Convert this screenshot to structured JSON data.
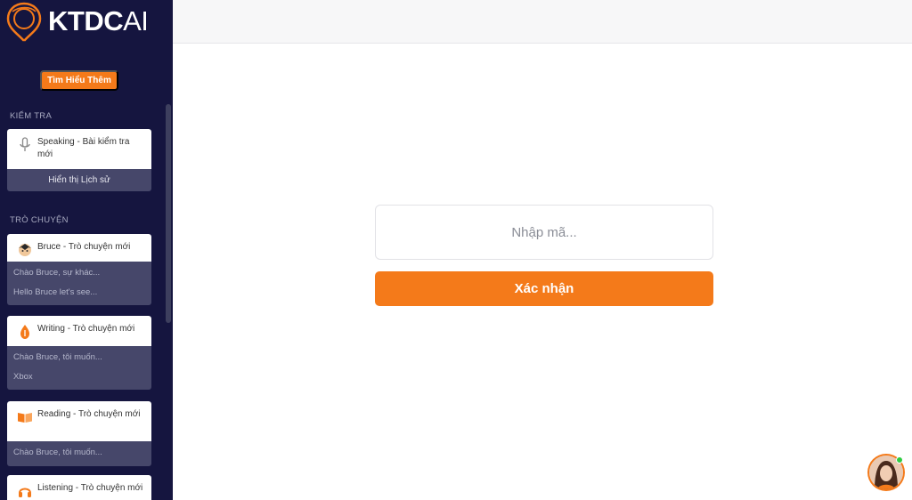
{
  "brand": {
    "name": "KTDC",
    "suffix": "AI"
  },
  "sidebar": {
    "cta_label": "Tìm Hiểu Thêm",
    "sections": {
      "test": "KIỂM TRA",
      "chat": "TRÒ CHUYỆN"
    },
    "test_card": {
      "title": "Speaking - Bài kiểm tra mới",
      "icon": "microphone-icon",
      "history_label": "Hiển thị Lịch sử"
    },
    "chats": [
      {
        "title": "Bruce - Trò chuyện mới",
        "icon": "bruce-avatar-icon",
        "messages": [
          "Chào Bruce, sự khác...",
          "Hello Bruce let's see..."
        ]
      },
      {
        "title": "Writing - Trò chuyện mới",
        "icon": "pen-nib-icon",
        "messages": [
          "Chào Bruce, tôi muốn...",
          "Xbox"
        ]
      },
      {
        "title": "Reading - Trò chuyện mới",
        "icon": "book-icon",
        "messages": [
          "Chào Bruce, tôi muốn..."
        ]
      },
      {
        "title": "Listening - Trò chuyện mới",
        "icon": "headphones-icon",
        "messages": []
      }
    ]
  },
  "main": {
    "code_placeholder": "Nhập mã...",
    "confirm_label": "Xác nhận"
  },
  "colors": {
    "accent": "#f47a1a",
    "sidebar_bg": "#15153f",
    "card_body": "#46476a",
    "online": "#2ecc40"
  }
}
